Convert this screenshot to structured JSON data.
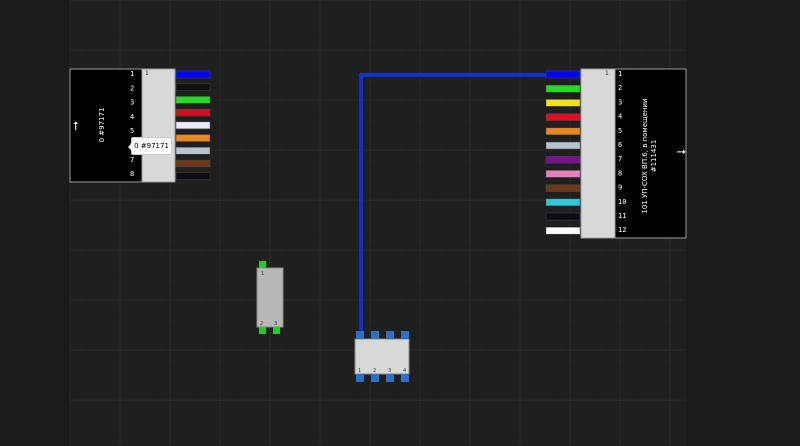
{
  "colors": {
    "background": "#1b1b1b",
    "grid_minor": "#2a2a2a",
    "grid_major": "#3c3c3c",
    "wire": "#1030d0",
    "pin_active": "#22cc22",
    "pin_blue": "#2e6fc7"
  },
  "connector_left": {
    "label": "0 #97171",
    "arrow": "arrow-left-icon",
    "pins": [
      "1",
      "2",
      "3",
      "4",
      "5",
      "6",
      "7",
      "8"
    ],
    "header_pin": "1",
    "wires": [
      "#0000ff",
      "#101010",
      "#22dd22",
      "#cc1122",
      "#e8e8ff",
      "#e88a22",
      "#b8c4d0",
      "#6b3a1a",
      "#0c0c18"
    ]
  },
  "connector_right": {
    "label_line1": "101 УП-COX ВП.6, в помещении",
    "label_line2": "#111431",
    "arrow": "arrow-right-icon",
    "pins": [
      "1",
      "2",
      "3",
      "4",
      "5",
      "6",
      "7",
      "8",
      "9",
      "10",
      "11",
      "12"
    ],
    "header_pin": "1",
    "wires": [
      "#0000ff",
      "#22dd22",
      "#f0e020",
      "#dd1122",
      "#e88a22",
      "#b8c4d0",
      "#7a1090",
      "#e880c0",
      "#6b3a1a",
      "#30c8d8",
      "#0c0c18",
      "#ffffff"
    ]
  },
  "tooltip": {
    "text": "0 #97171"
  },
  "splice": {
    "top_pin": "1",
    "bottom_pins": [
      "2",
      "3"
    ]
  },
  "module": {
    "pins": [
      "1",
      "2",
      "3",
      "4"
    ]
  }
}
